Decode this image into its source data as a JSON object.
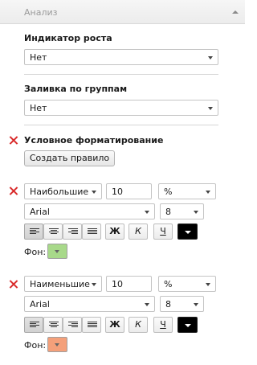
{
  "header": {
    "title": "Анализ"
  },
  "growth_indicator": {
    "label": "Индикатор роста",
    "value": "Нет"
  },
  "group_fill": {
    "label": "Заливка по группам",
    "value": "Нет"
  },
  "conditional_formatting": {
    "label": "Условное форматирование",
    "create_rule_label": "Создать правило"
  },
  "rules": [
    {
      "type": "Наибольшие",
      "count": "10",
      "unit": "%",
      "font": "Arial",
      "size": "8",
      "bold": "Ж",
      "italic": "К",
      "underline": "Ч",
      "fon_label": "Фон:",
      "fon_color": "#a8d98a",
      "text_color": "#000000"
    },
    {
      "type": "Наименьшие",
      "count": "10",
      "unit": "%",
      "font": "Arial",
      "size": "8",
      "bold": "Ж",
      "italic": "К",
      "underline": "Ч",
      "fon_label": "Фон:",
      "fon_color": "#f4a07a",
      "text_color": "#000000"
    }
  ]
}
